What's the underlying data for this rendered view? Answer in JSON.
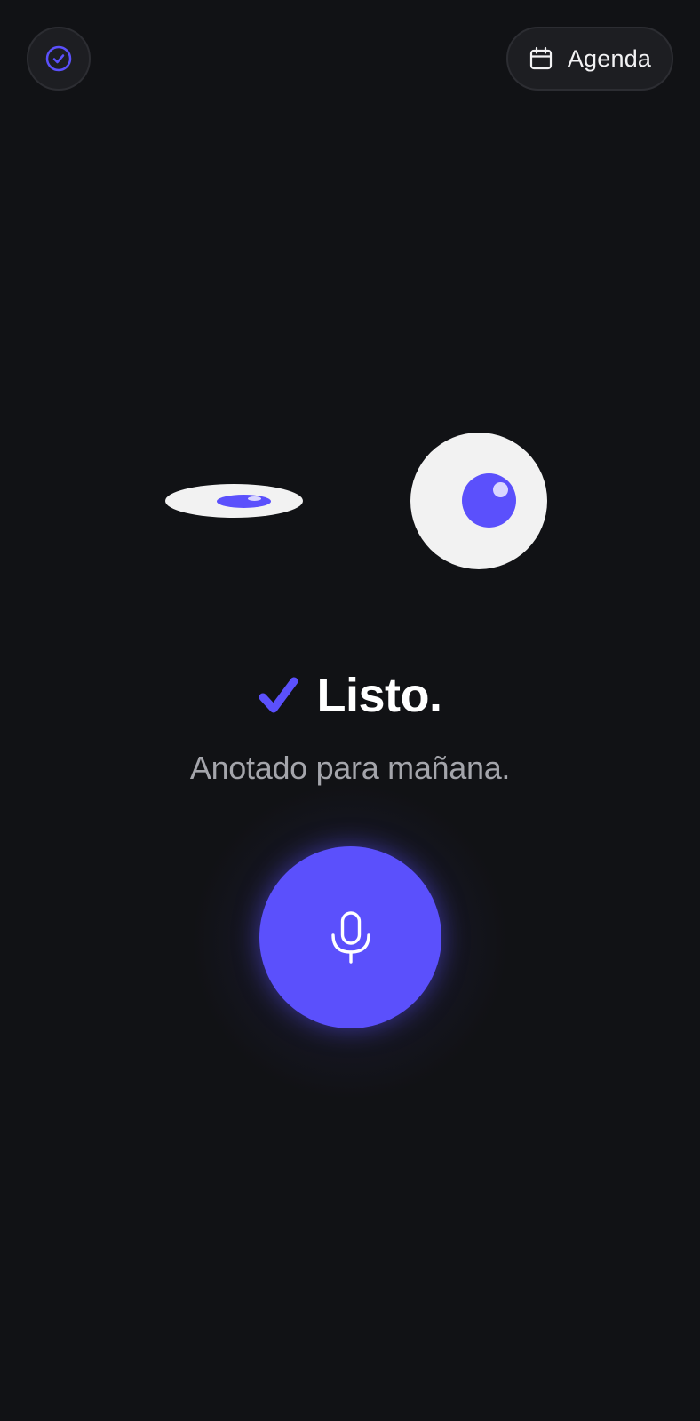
{
  "header": {
    "status_icon": "check-circle-icon",
    "agenda": {
      "icon": "calendar-icon",
      "label": "Agenda"
    }
  },
  "face": {
    "left_eye": "winking",
    "right_eye": "open"
  },
  "confirmation": {
    "icon": "checkmark-icon",
    "title": "Listo.",
    "subtitle": "Anotado para mañana."
  },
  "mic": {
    "icon": "microphone-icon"
  },
  "colors": {
    "background": "#111215",
    "accent": "#5b50fc",
    "button_bg": "#1d1e22",
    "eye_white": "#f2f2f2",
    "subtitle_text": "#a4a5ab"
  }
}
